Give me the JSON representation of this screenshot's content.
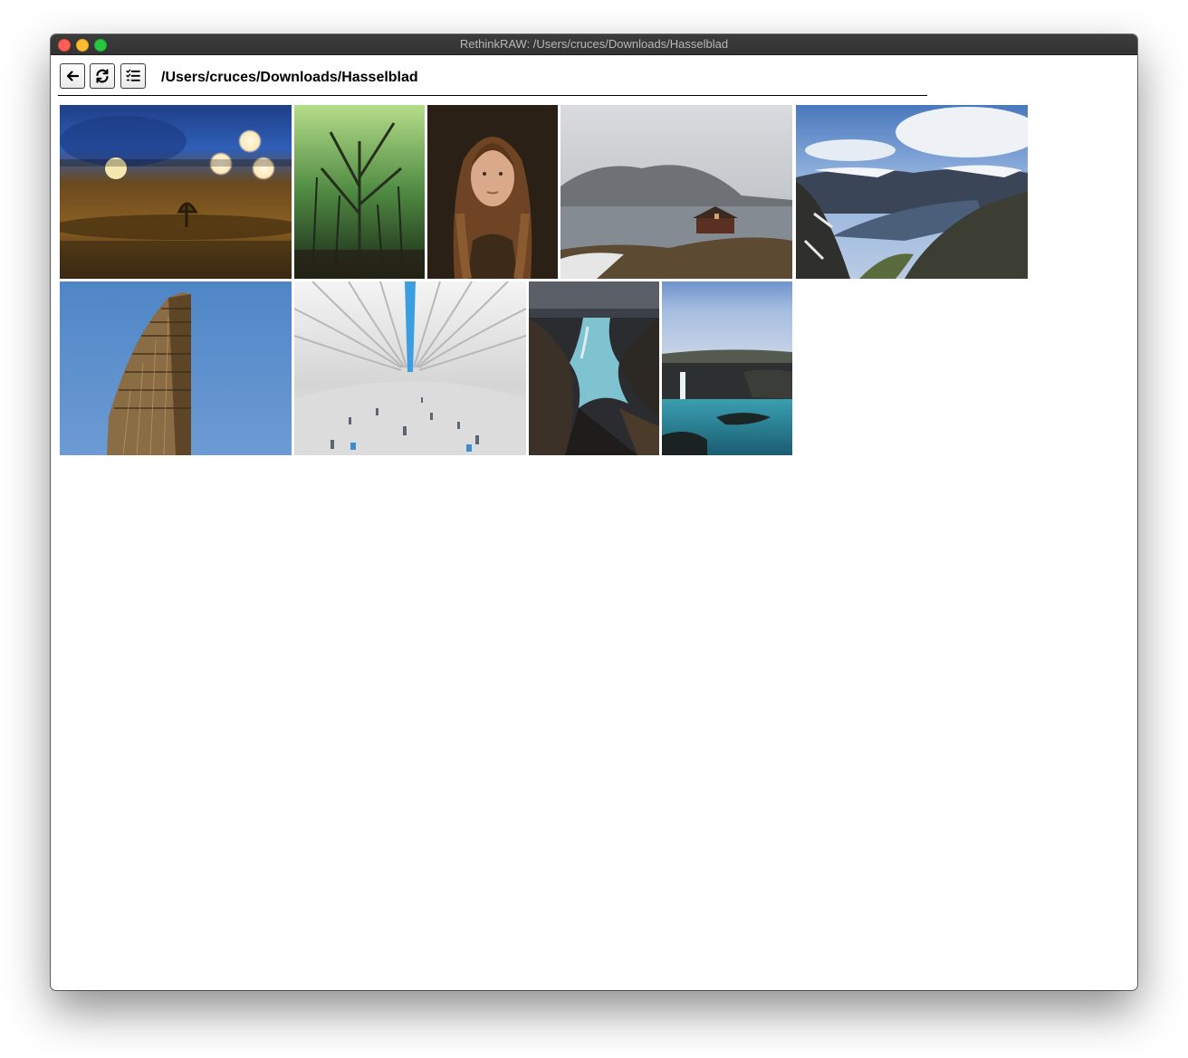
{
  "window": {
    "title": "RethinkRAW: /Users/cruces/Downloads/Hasselblad"
  },
  "toolbar": {
    "buttons": [
      {
        "name": "back",
        "icon": "arrow-left-icon"
      },
      {
        "name": "refresh",
        "icon": "refresh-icon"
      },
      {
        "name": "batch",
        "icon": "tasks-icon"
      }
    ],
    "path": "/Users/cruces/Downloads/Hasselblad"
  },
  "gallery": {
    "photos": [
      {
        "subject": "tiny tree bokeh lights",
        "colors": [
          "#2c5fb5",
          "#7a4f1a",
          "#3d2a12"
        ]
      },
      {
        "subject": "green forest",
        "colors": [
          "#9fcf74",
          "#3f7a3a",
          "#1f2e1a"
        ]
      },
      {
        "subject": "portrait woman",
        "colors": [
          "#2a2118",
          "#9a6a45",
          "#3b2a1d"
        ]
      },
      {
        "subject": "lake cabin mist",
        "colors": [
          "#cfd2d6",
          "#7b7f84",
          "#5a4a35"
        ]
      },
      {
        "subject": "fjord mountains",
        "colors": [
          "#5f86c4",
          "#e8edf2",
          "#3c3d36"
        ]
      },
      {
        "subject": "flatiron building",
        "colors": [
          "#5d8fcf",
          "#8a6a3c",
          "#2e2416"
        ]
      },
      {
        "subject": "oculus station",
        "colors": [
          "#f0f0f0",
          "#c4c4c4",
          "#4aa3e0"
        ]
      },
      {
        "subject": "river canyon",
        "colors": [
          "#3a4049",
          "#7dc1cf",
          "#1f2022"
        ]
      },
      {
        "subject": "waterfall sea cliffs",
        "colors": [
          "#7a9bd0",
          "#2b8fa0",
          "#1e2a2c"
        ]
      }
    ]
  }
}
